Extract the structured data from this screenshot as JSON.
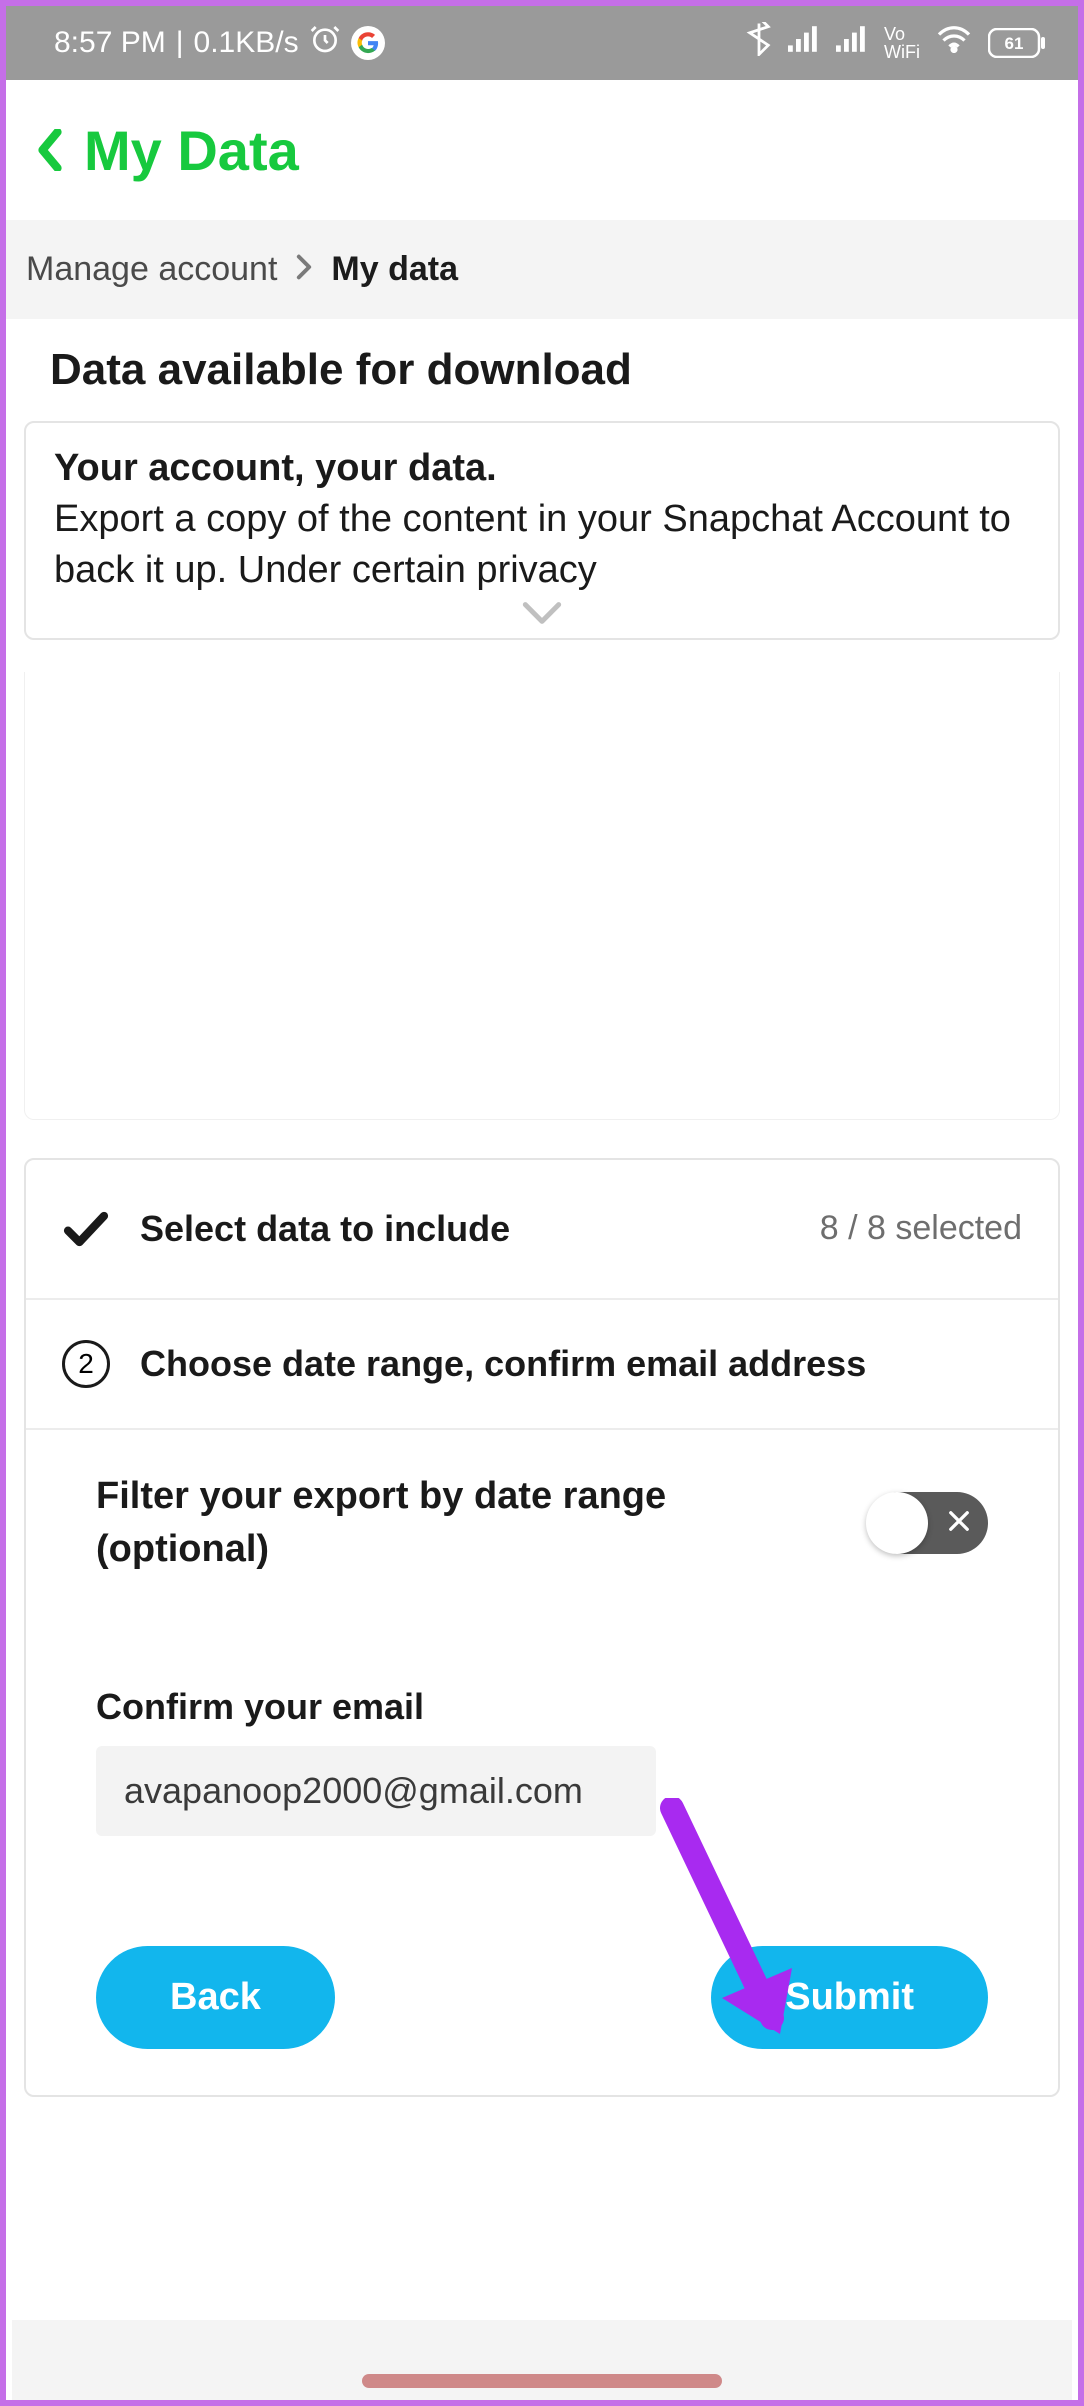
{
  "status": {
    "time": "8:57 PM",
    "net_speed": "0.1KB/s",
    "wifi_label": "Vo WiFi",
    "battery": "61"
  },
  "header": {
    "title": "My Data"
  },
  "breadcrumb": {
    "parent": "Manage account",
    "current": "My data"
  },
  "section": {
    "title": "Data available for download"
  },
  "intro": {
    "heading": "Your account, your data.",
    "body": "Export a copy of the content in your Snapchat Account to back it up. Under certain privacy"
  },
  "steps": {
    "step1": {
      "label": "Select data to include",
      "meta": "8 / 8 selected"
    },
    "step2": {
      "number": "2",
      "label": "Choose date range, confirm email address"
    }
  },
  "filter": {
    "label": "Filter your export by date range (optional)"
  },
  "email": {
    "label": "Confirm your email",
    "value": "avapanoop2000@gmail.com"
  },
  "buttons": {
    "back": "Back",
    "submit": "Submit"
  }
}
